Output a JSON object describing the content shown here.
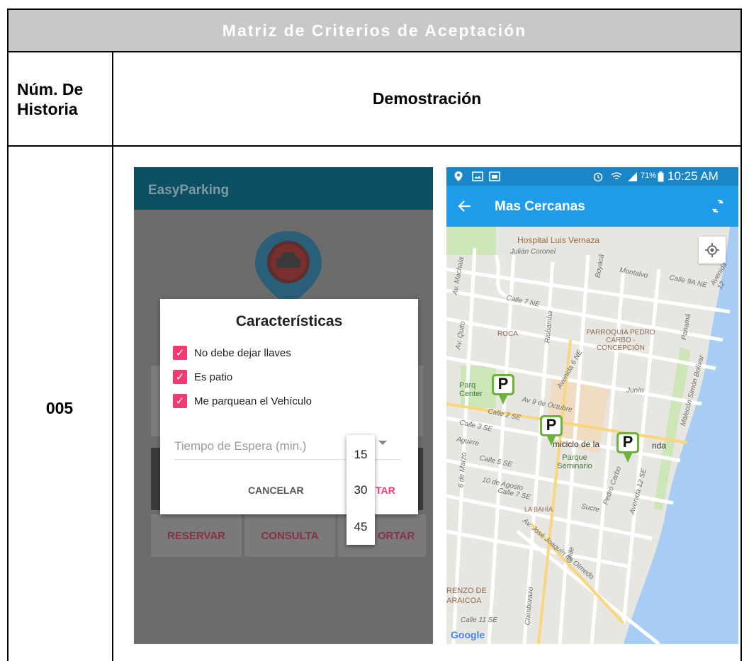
{
  "table": {
    "title": "Matriz de Criterios de Aceptación",
    "col1_header": "Núm. De Historia",
    "col2_header": "Demostración",
    "story_number": "005"
  },
  "left_screen": {
    "app_title": "EasyParking",
    "dialog": {
      "title": "Características",
      "options": [
        {
          "label": "No debe dejar llaves",
          "checked": true
        },
        {
          "label": "Es patio",
          "checked": true
        },
        {
          "label": "Me parquean el Vehículo",
          "checked": true
        }
      ],
      "wait_label": "Tiempo de Espera (min.)",
      "wait_options": [
        "15",
        "30",
        "45"
      ],
      "cancel_label": "CANCELAR",
      "accept_label_partial": "TAR"
    },
    "bottom_buttons": [
      "RESERVAR",
      "CONSULTA",
      "ORTAR"
    ]
  },
  "right_screen": {
    "status": {
      "battery": "71%",
      "time": "10:25 AM"
    },
    "toolbar_title": "Mas Cercanas",
    "map_labels": {
      "hospital": "Hospital Luis Vernaza",
      "julian": "Julián Coronel",
      "montalvo": "Montalvo",
      "calle9a": "Calle 9A NE",
      "av12": "Avenida 12",
      "calle7ne": "Calle 7 NE",
      "boyaca": "Boyacá",
      "machala": "Av. Machala",
      "quito": "Av. Quito",
      "roca": "ROCA",
      "riobamba": "Riobamba",
      "parroquia": "PARROQUIA PEDRO CARBO - CONCEPCIÓN",
      "panama": "Panamá",
      "malecon": "Malecón Simón Bolívar",
      "av6ne": "Avenida 6 NE",
      "junin": "Junín",
      "parque_centen": "Parq Center",
      "av9oct": "Av 9 de Octubre",
      "calle2se": "Calle 2 SE",
      "calle3se": "Calle 3 SE",
      "aguirre": "Aguirre",
      "hemiciclo": "miciclo de la",
      "rotonda": "nda",
      "parque_seminario": "Parque Seminario",
      "calle5se": "Calle 5 SE",
      "diez_agosto": "10 de Agosto",
      "seis_marzo": "6 de Marzo",
      "calle7se": "Calle 7 SE",
      "sucre": "Sucre",
      "pedro_carbo": "Pedro Carbo",
      "la_bahia": "LA BAHÍA",
      "av12se": "Avenida 12 SE",
      "jose_joaquin": "Av. José Joaquín de Olmedo",
      "chile": "Chile",
      "chimborazo": "Chimborazo",
      "lorenzo": "RENZO DE",
      "garaicoa": "ARAICOA",
      "calle11se": "Calle 11 SE",
      "google": "Google"
    },
    "marker_letter": "P"
  },
  "colors": {
    "header_bg": "#c8c8c8",
    "appbar_dark": "#0c4f63",
    "toolbar_blue": "#1e9be9",
    "check_pink": "#ef3b72",
    "marker_green": "#6ab43b"
  }
}
